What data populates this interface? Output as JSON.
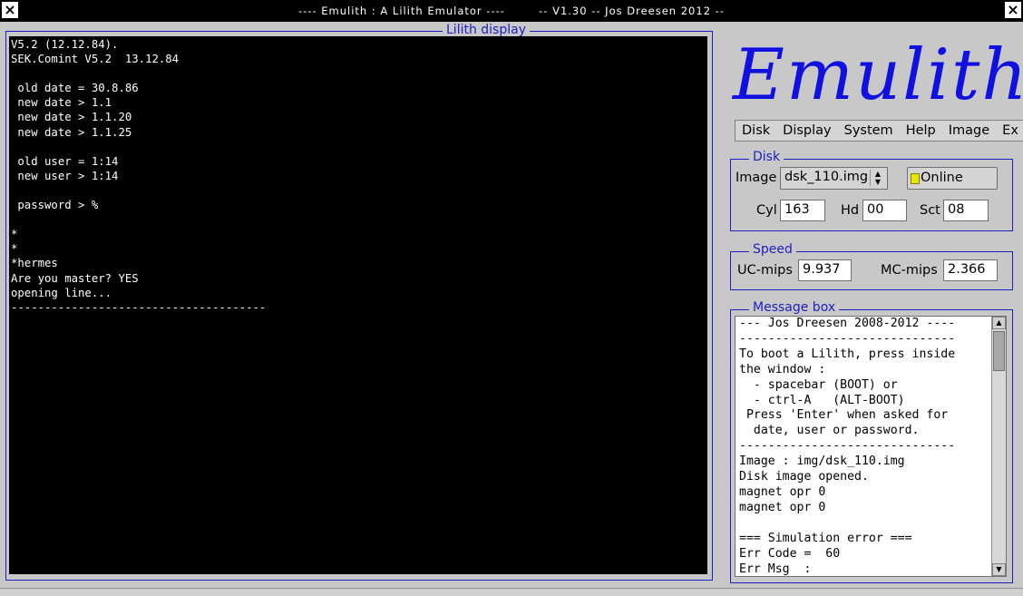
{
  "window": {
    "title": "---- Emulith : A Lilith Emulator ----        -- V1.30 -- Jos Dreesen 2012 --",
    "close_left": "×",
    "close_right": "×"
  },
  "display": {
    "label": "Lilith display",
    "lines": "V5.2 (12.12.84).\nSEK.Comint V5.2  13.12.84\n\n old date = 30.8.86\n new date > 1.1\n new date > 1.1.20\n new date > 1.1.25\n\n old user = 1:14\n new user > 1:14\n\n password > %\n\n*\n*\n*hermes\nAre you master? YES\nopening line...\n--------------------------------------"
  },
  "logo": {
    "text": "Emulith"
  },
  "menu": {
    "items": [
      "Disk",
      "Display",
      "System",
      "Help",
      "Image",
      "Ex"
    ]
  },
  "disk": {
    "label": "Disk",
    "image_label": "Image",
    "image_value": "dsk_110.img",
    "online_label": "Online",
    "cyl_label": "Cyl",
    "cyl_value": "163",
    "hd_label": "Hd",
    "hd_value": "00",
    "sct_label": "Sct",
    "sct_value": "08"
  },
  "speed": {
    "label": "Speed",
    "uc_label": "UC-mips",
    "uc_value": "9.937",
    "mc_label": "MC-mips",
    "mc_value": "2.366"
  },
  "messages": {
    "label": "Message box",
    "text": "--- Jos Dreesen 2008-2012 ----\n------------------------------\nTo boot a Lilith, press inside\nthe window :\n  - spacebar (BOOT) or\n  - ctrl-A   (ALT-BOOT)\n Press 'Enter' when asked for\n  date, user or password.\n------------------------------\nImage : img/dsk_110.img\nDisk image opened.\nmagnet opr 0\nmagnet opr 0\n\n=== Simulation error ===\nErr Code =  60\nErr Msg  :"
  },
  "colors": {
    "accent": "#2020c0",
    "logo": "#1010e0",
    "led": "#e8e800"
  }
}
